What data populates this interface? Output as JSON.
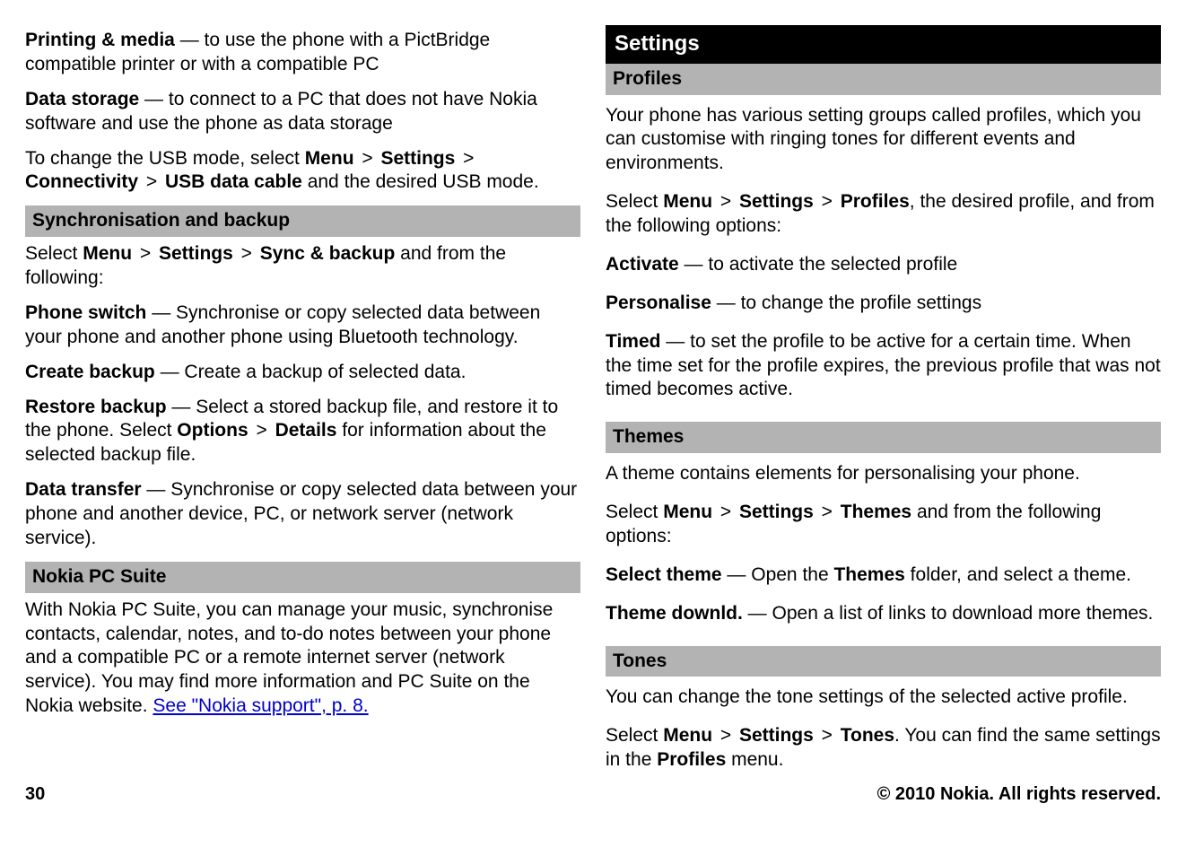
{
  "left": {
    "printing_media_label": "Printing & media",
    "printing_media_desc": " — to use the phone with a PictBridge compatible printer or with a compatible PC",
    "data_storage_label": "Data storage",
    "data_storage_desc": " — to connect to a PC that does not have Nokia software and use the phone as data storage",
    "usb_pre": "To change the USB mode, select ",
    "menu": "Menu",
    "gt": " > ",
    "settings": "Settings",
    "connectivity": "Connectivity",
    "usb_data_cable": "USB data cable",
    "usb_post": " and the desired USB mode.",
    "sync_heading": "Synchronisation and backup",
    "sync_select_pre": "Select ",
    "sync_backup": "Sync & backup",
    "sync_select_post": " and from the following:",
    "phone_switch_label": "Phone switch",
    "phone_switch_desc": " — Synchronise or copy selected data between your phone and another phone using Bluetooth technology.",
    "create_backup_label": "Create backup",
    "create_backup_desc": " — Create a backup of selected data.",
    "restore_backup_label": "Restore backup",
    "restore_backup_desc_pre": " — Select a stored backup file, and restore it to the phone. Select ",
    "options": "Options",
    "details": "Details",
    "restore_backup_desc_post": " for information about the selected backup file.",
    "data_transfer_label": "Data transfer",
    "data_transfer_desc": " — Synchronise or copy selected data between your phone and another device, PC, or network server (network service).",
    "pcsuite_heading": "Nokia PC Suite",
    "pcsuite_body": "With Nokia PC Suite, you can manage your music, synchronise contacts, calendar, notes, and to-do notes between your phone and a compatible PC or a remote internet server (network service). You may find more information and PC Suite on the Nokia website. ",
    "pcsuite_link": "See \"Nokia support\", p. 8."
  },
  "right": {
    "section_title": "Settings",
    "profiles_heading": "Profiles",
    "profiles_intro": "Your phone has various setting groups called profiles, which you can customise with ringing tones for different events and environments.",
    "profiles_select_pre": "Select ",
    "menu": "Menu",
    "gt": " > ",
    "settings": "Settings",
    "profiles": "Profiles",
    "profiles_select_post": ", the desired profile, and from the following options:",
    "activate_label": "Activate",
    "activate_desc": " — to activate the selected profile",
    "personalise_label": "Personalise",
    "personalise_desc": " — to change the profile settings",
    "timed_label": "Timed",
    "timed_desc": " — to set the profile to be active for a certain time. When the time set for the profile expires, the previous profile that was not timed becomes active.",
    "themes_heading": "Themes",
    "themes_intro": "A theme contains elements for personalising your phone.",
    "themes_select_pre": "Select ",
    "themes": "Themes",
    "themes_select_post": " and from the following options:",
    "select_theme_label": "Select theme",
    "select_theme_desc_pre": " — Open the ",
    "themes_folder": "Themes",
    "select_theme_desc_post": " folder, and select a theme.",
    "theme_downld_label": "Theme downld.",
    "theme_downld_desc": " — Open a list of links to download more themes.",
    "tones_heading": "Tones",
    "tones_intro": "You can change the tone settings of the selected active profile.",
    "tones_select_pre": "Select ",
    "tones": "Tones",
    "tones_select_mid": ". You can find the same settings in the ",
    "profiles_menu": "Profiles",
    "tones_select_post": " menu."
  },
  "footer": {
    "page_number": "30",
    "copyright": "© 2010 Nokia. All rights reserved."
  }
}
